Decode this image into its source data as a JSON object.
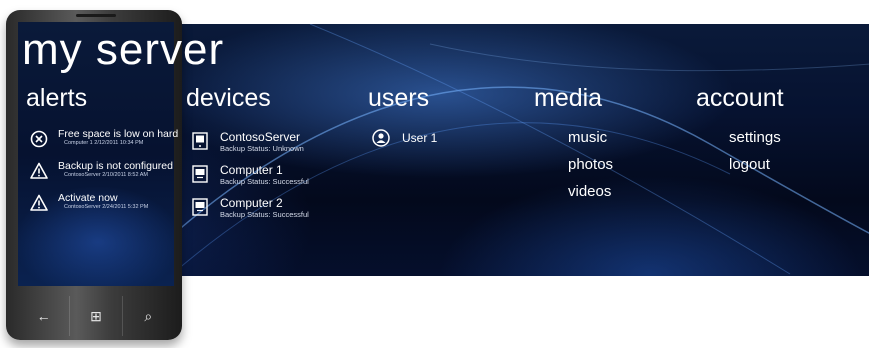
{
  "app": {
    "title": "my server"
  },
  "sections": {
    "alerts": "alerts",
    "devices": "devices",
    "users": "users",
    "media": "media",
    "account": "account"
  },
  "alerts": [
    {
      "icon": "error-circle-icon",
      "title": "Free space is low on hard",
      "detail": "Computer 1 2/12/2011 10:34 PM"
    },
    {
      "icon": "warning-triangle-icon",
      "title": "Backup is not configured",
      "detail": "ContosoServer 2/10/2011 8:52 AM"
    },
    {
      "icon": "warning-triangle-icon",
      "title": "Activate now",
      "detail": "ContosoServer 2/24/2011 5:32 PM"
    }
  ],
  "devices": [
    {
      "icon": "server-icon",
      "name": "ContosoServer",
      "status": "Backup Status: Unknown"
    },
    {
      "icon": "computer-icon",
      "name": "Computer 1",
      "status": "Backup Status: Successful"
    },
    {
      "icon": "computer-icon",
      "name": "Computer 2",
      "status": "Backup Status: Successful"
    }
  ],
  "users": [
    {
      "icon": "user-icon",
      "name": "User 1"
    }
  ],
  "media": {
    "items": [
      "music",
      "photos",
      "videos"
    ]
  },
  "account": {
    "items": [
      "settings",
      "logout"
    ]
  },
  "phone": {
    "buttons": [
      {
        "icon": "back-arrow-icon",
        "glyph": "←"
      },
      {
        "icon": "windows-start-icon",
        "glyph": "⊞"
      },
      {
        "icon": "search-icon",
        "glyph": "⌕"
      }
    ]
  },
  "colors": {
    "background_dark": "#061230",
    "accent_blue": "#3a78d8",
    "text": "#ffffff"
  }
}
